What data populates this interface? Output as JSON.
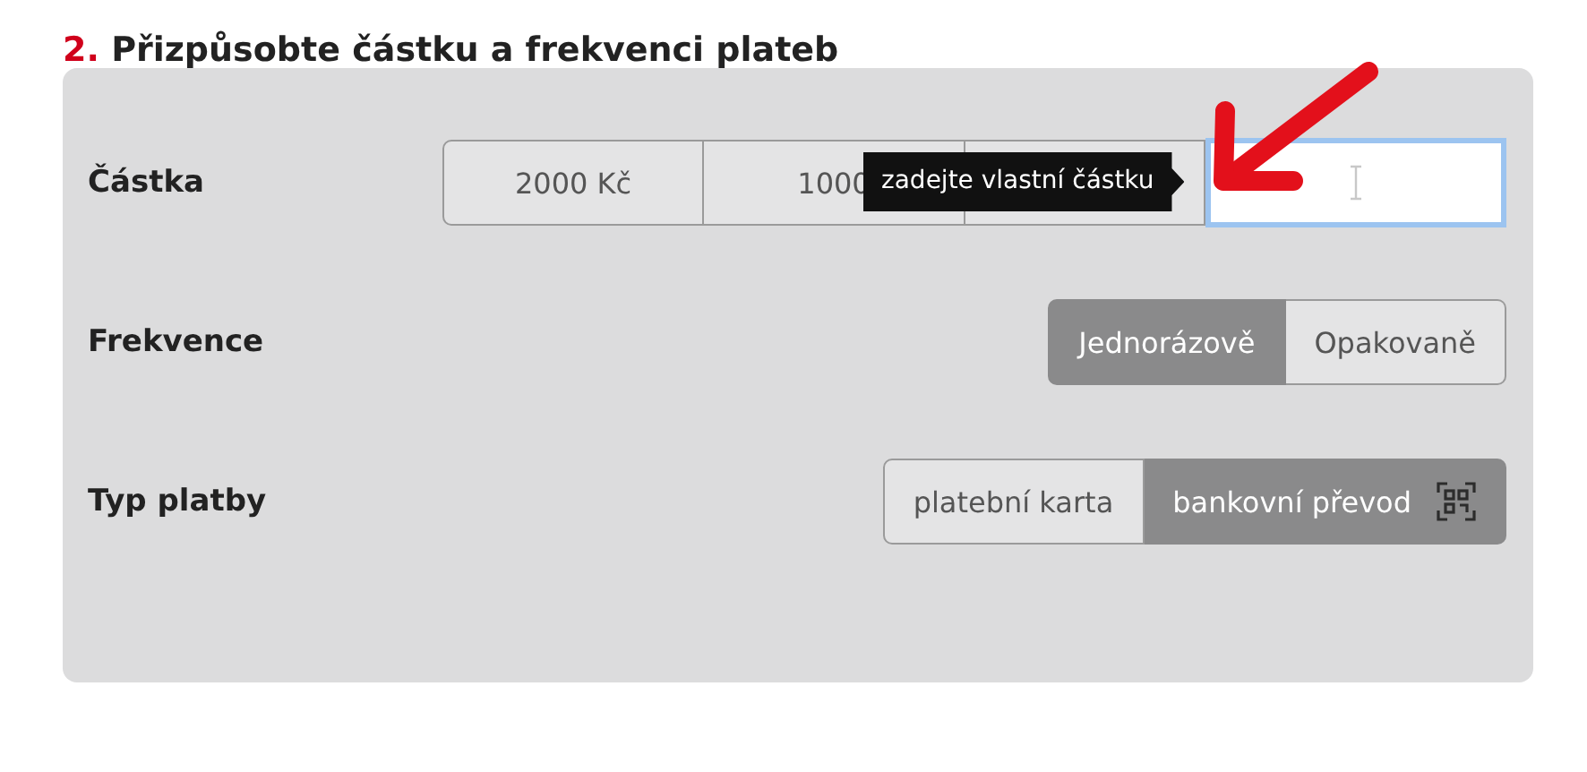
{
  "heading": {
    "number": "2.",
    "text": "Přizpůsobte částku a frekvenci plateb"
  },
  "amount": {
    "label": "Částka",
    "options": [
      {
        "kind": "option",
        "label": "2000 Kč"
      },
      {
        "kind": "option",
        "label": "1000"
      },
      {
        "kind": "covered"
      }
    ],
    "tooltip": "zadejte vlastní částku",
    "input": {
      "focused": true
    }
  },
  "frequency": {
    "label": "Frekvence",
    "options": [
      {
        "label": "Jednorázově",
        "selected": true
      },
      {
        "label": "Opakovaně",
        "selected": false
      }
    ]
  },
  "payment_type": {
    "label": "Typ platby",
    "options": [
      {
        "label": "platební karta",
        "selected": false,
        "icon": false
      },
      {
        "label": "bankovní převod",
        "selected": true,
        "icon": true
      }
    ]
  },
  "annotation": {
    "kind": "arrow"
  }
}
